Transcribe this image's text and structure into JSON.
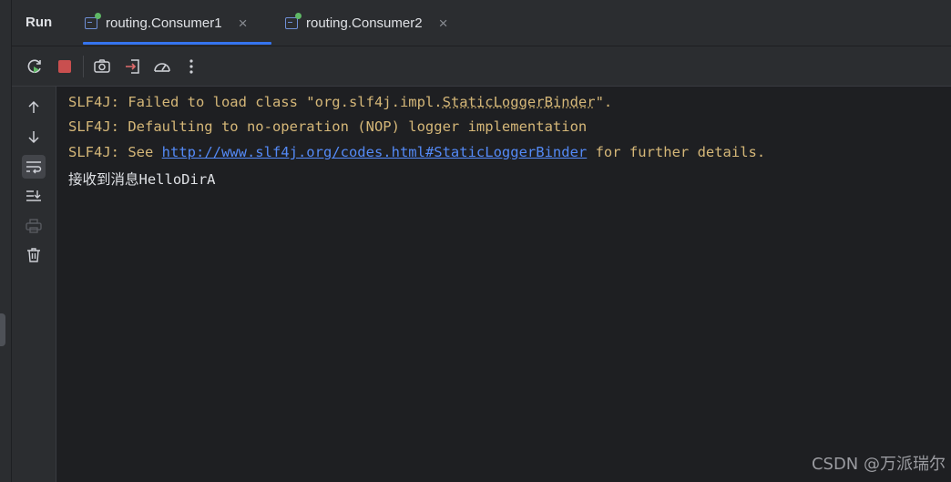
{
  "tabbar": {
    "run_label": "Run",
    "tabs": [
      {
        "label": "routing.Consumer1",
        "close": "×",
        "active": true
      },
      {
        "label": "routing.Consumer2",
        "close": "×",
        "active": false
      }
    ]
  },
  "toolbar": {
    "icons": [
      "rerun-icon",
      "stop-icon",
      "screenshot-icon",
      "login-icon",
      "profiler-icon",
      "more-icon"
    ]
  },
  "sidebar": {
    "icons": [
      "arrow-up-icon",
      "arrow-down-icon",
      "soft-wrap-icon",
      "scroll-to-end-icon",
      "print-icon",
      "trash-icon"
    ]
  },
  "console": {
    "line1": {
      "pre": "SLF4J: Failed to load class \"org.slf4j.impl.",
      "dotted": "StaticLoggerBinder",
      "post": "\"."
    },
    "line2": "SLF4J: Defaulting to no-operation (NOP) logger implementation",
    "line3": {
      "pre": "SLF4J: See ",
      "link": "http://www.slf4j.org/codes.html#StaticLoggerBinder",
      "post": " for further details."
    },
    "line4": "接收到消息HelloDirA"
  },
  "watermark": "CSDN @万派瑞尔",
  "colors": {
    "background": "#1e1f22",
    "panel": "#2b2d30",
    "accent": "#3574f0",
    "log_yellow": "#d5b778",
    "link": "#548af7",
    "stop_red": "#c94f4f",
    "run_green": "#5fb865"
  }
}
